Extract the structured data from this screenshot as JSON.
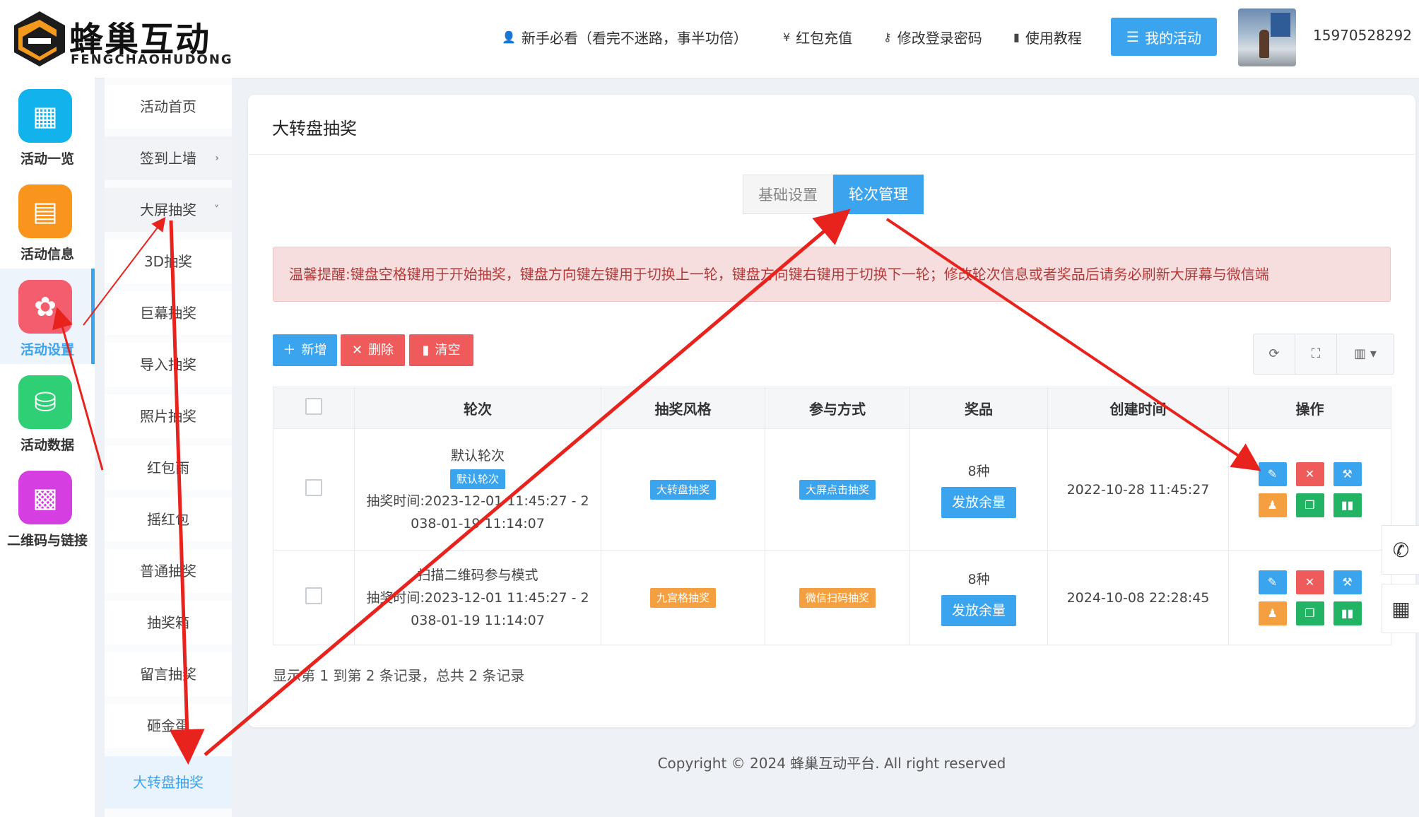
{
  "header": {
    "logo_cn": "蜂巢互动",
    "logo_en": "FENGCHAOHUDONG",
    "nav": [
      {
        "icon": "user-icon",
        "glyph": "👤",
        "label": "新手必看（看完不迷路，事半功倍）"
      },
      {
        "icon": "yen-icon",
        "glyph": "¥",
        "label": "红包充值"
      },
      {
        "icon": "key-icon",
        "glyph": "⚷",
        "label": "修改登录密码"
      },
      {
        "icon": "document-icon",
        "glyph": "▮",
        "label": "使用教程"
      }
    ],
    "my_activity": "我的活动",
    "phone": "15970528292"
  },
  "sidebar": {
    "items": [
      {
        "label": "活动一览",
        "icon": "grid-icon",
        "glyph": "▦",
        "color": "#12b3ec"
      },
      {
        "label": "活动信息",
        "icon": "file-icon",
        "glyph": "▤",
        "color": "#f9951c"
      },
      {
        "label": "活动设置",
        "icon": "gear-icon",
        "glyph": "✿",
        "color": "#f45d6d"
      },
      {
        "label": "活动数据",
        "icon": "database-icon",
        "glyph": "⛁",
        "color": "#2ecf75"
      },
      {
        "label": "二维码与链接",
        "icon": "qrcode-icon",
        "glyph": "▩",
        "color": "#d53ee0"
      }
    ]
  },
  "subnav": [
    {
      "label": "活动首页"
    },
    {
      "label": "签到上墙",
      "chevron": "›"
    },
    {
      "label": "大屏抽奖",
      "chevron": "˅"
    },
    {
      "label": "3D抽奖"
    },
    {
      "label": "巨幕抽奖"
    },
    {
      "label": "导入抽奖"
    },
    {
      "label": "照片抽奖"
    },
    {
      "label": "红包雨"
    },
    {
      "label": "摇红包"
    },
    {
      "label": "普通抽奖"
    },
    {
      "label": "抽奖箱"
    },
    {
      "label": "留言抽奖"
    },
    {
      "label": "砸金蛋"
    },
    {
      "label": "大转盘抽奖"
    }
  ],
  "main": {
    "title": "大转盘抽奖",
    "tabs": [
      "基础设置",
      "轮次管理"
    ],
    "alert": "温馨提醒:键盘空格键用于开始抽奖，键盘方向键左键用于切换上一轮，键盘方向键右键用于切换下一轮；修改轮次信息或者奖品后请务必刷新大屏幕与微信端",
    "toolbar": {
      "add": "新增",
      "delete": "删除",
      "clear": "清空"
    },
    "columns": [
      "轮次",
      "抽奖风格",
      "参与方式",
      "奖品",
      "创建时间",
      "操作"
    ],
    "rows": [
      {
        "name": "默认轮次",
        "badge": "默认轮次",
        "time_line1": "抽奖时间:2023-12-01 11:45:27 - 2",
        "time_line2": "038-01-19 11:14:07",
        "style": "大转盘抽奖",
        "join": "大屏点击抽奖",
        "prizes": "8种",
        "quota_btn": "发放余量",
        "created": "2022-10-28 11:45:27"
      },
      {
        "name": "扫描二维码参与模式",
        "badge": "",
        "time_line1": "抽奖时间:2023-12-01 11:45:27 - 2",
        "time_line2": "038-01-19 11:14:07",
        "style": "九宫格抽奖",
        "join": "微信扫码抽奖",
        "prizes": "8种",
        "quota_btn": "发放余量",
        "created": "2024-10-08 22:28:45"
      }
    ],
    "record_text": "显示第 1 到第 2 条记录，总共 2 条记录"
  },
  "footer": "Copyright © 2024 蜂巢互动平台. All right reserved"
}
